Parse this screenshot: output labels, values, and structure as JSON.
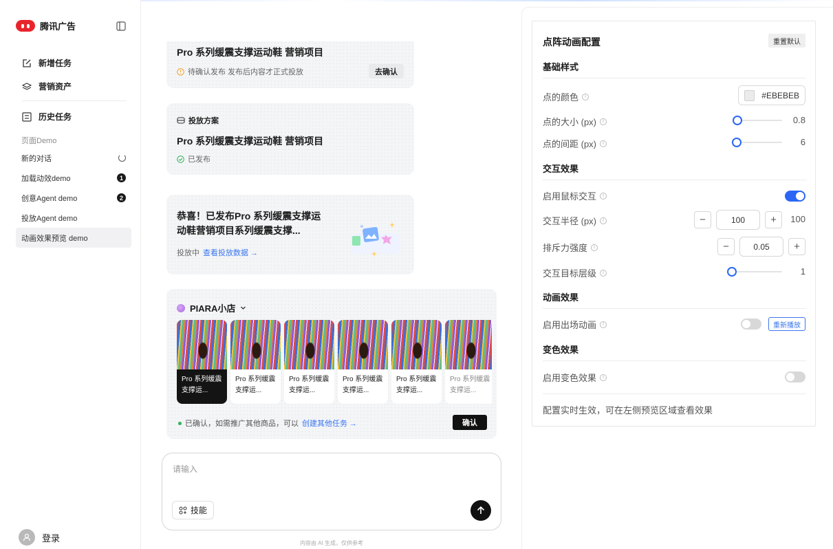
{
  "sidebar": {
    "brand": "腾讯广告",
    "nav": [
      {
        "label": "新增任务",
        "icon": "edit-icon"
      },
      {
        "label": "营销资产",
        "icon": "layers-icon"
      },
      {
        "label": "历史任务",
        "icon": "list-icon"
      }
    ],
    "section_label": "页面Demo",
    "demos": [
      {
        "label": "新的对话",
        "status": "loading"
      },
      {
        "label": "加载动效demo",
        "badge": "1"
      },
      {
        "label": "创意Agent demo",
        "badge": "2"
      },
      {
        "label": "投放Agent demo"
      },
      {
        "label": "动画效果预览 demo",
        "active": true
      }
    ],
    "login": "登录"
  },
  "main": {
    "card1": {
      "title": "Pro 系列缓震支撑运动鞋 营销项目",
      "status": "待确认发布 发布后内容才正式投放",
      "action": "去确认"
    },
    "card2": {
      "tag": "投放方案",
      "title": "Pro 系列缓震支撑运动鞋 营销项目",
      "status": "已发布"
    },
    "card3": {
      "title": "恭喜！已发布Pro 系列缓震支撑运动鞋营销项目系列缓震支撑...",
      "status": "投放中",
      "link": "查看投放数据 →"
    },
    "card4": {
      "shop": "PIARA小店",
      "products": [
        {
          "name": "Pro 系列缓震支撑运...",
          "selected": true
        },
        {
          "name": "Pro 系列缓震支撑运..."
        },
        {
          "name": "Pro 系列缓震支撑运..."
        },
        {
          "name": "Pro 系列缓震支撑运..."
        },
        {
          "name": "Pro 系列缓震支撑运..."
        },
        {
          "name": "Pro 系列缓震支撑运...",
          "faded": true
        }
      ],
      "footer_text": "已确认，如需推广其他商品，可以",
      "footer_link": "创建其他任务 →",
      "confirm": "确认"
    },
    "input": {
      "placeholder": "请输入",
      "skill": "技能"
    },
    "disclaimer": "内容由 AI 生成，仅供参考"
  },
  "panel": {
    "title": "点阵动画配置",
    "reset": "重置默认",
    "sections": {
      "basic": "基础样式",
      "interaction": "交互效果",
      "animation": "动画效果",
      "color": "变色效果"
    },
    "dot_color": {
      "label": "点的颜色",
      "value": "#EBEBEB"
    },
    "dot_size": {
      "label": "点的大小 (px)",
      "value": "0.8",
      "fraction": 0.08
    },
    "dot_gap": {
      "label": "点的间距 (px)",
      "value": "6",
      "fraction": 0.05
    },
    "mouse": {
      "label": "启用鼠标交互",
      "on": true
    },
    "radius": {
      "label": "交互半径 (px)",
      "value": "100",
      "display": "100"
    },
    "repel": {
      "label": "排斥力强度",
      "value": "0.05"
    },
    "layer": {
      "label": "交互目标层级",
      "value": "1",
      "fraction": 0.0
    },
    "intro": {
      "label": "启用出场动画",
      "on": false,
      "replay": "重新播放"
    },
    "colorfx": {
      "label": "启用变色效果",
      "on": false
    },
    "footer": "配置实时生效，可在左侧预览区域查看效果",
    "accent": "#2B66F5"
  }
}
